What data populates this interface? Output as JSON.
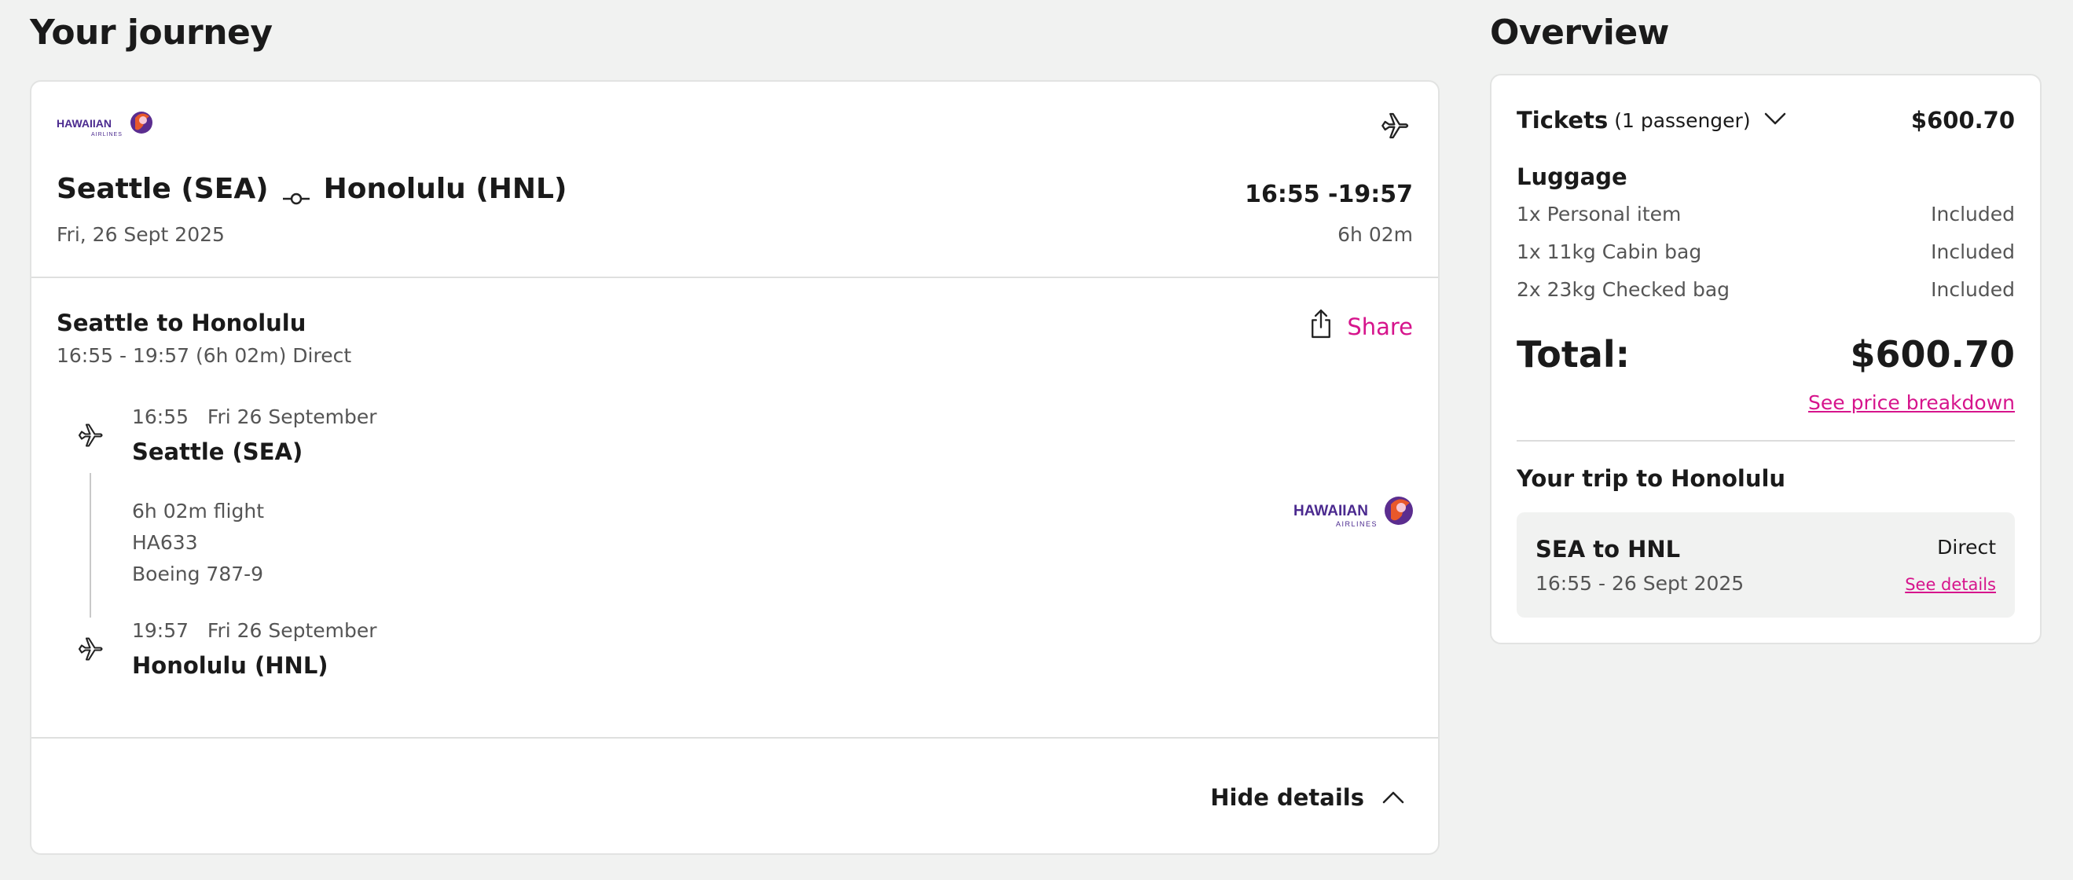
{
  "journey": {
    "title": "Your journey",
    "airline_logo_text": "HAWAIIAN",
    "airline_logo_subtext": "AIRLINES",
    "origin": "Seattle (SEA)",
    "destination": "Honolulu (HNL)",
    "date": "Fri, 26 Sept 2025",
    "time_range": "16:55 -19:57",
    "duration": "6h 02m",
    "leg": {
      "title": "Seattle to Honolulu",
      "subtitle": "16:55 - 19:57 (6h 02m) Direct",
      "share_label": "Share",
      "departure": {
        "time": "16:55   Fri 26 September",
        "name": "Seattle (SEA)"
      },
      "flight_duration": "6h 02m flight",
      "flight_number": "HA633",
      "aircraft": "Boeing 787-9",
      "arrival": {
        "time": "19:57   Fri 26 September",
        "name": "Honolulu (HNL)"
      }
    },
    "hide_details_label": "Hide details"
  },
  "overview": {
    "title": "Overview",
    "tickets_label": "Tickets",
    "tickets_passengers": "(1 passenger)",
    "tickets_price": "$600.70",
    "luggage_title": "Luggage",
    "luggage": [
      {
        "item": "1x Personal item",
        "status": "Included"
      },
      {
        "item": "1x 11kg Cabin bag",
        "status": "Included"
      },
      {
        "item": "2x 23kg Checked bag",
        "status": "Included"
      }
    ],
    "total_label": "Total:",
    "total_price": "$600.70",
    "price_breakdown_label": "See price breakdown",
    "trip_title": "Your trip to Honolulu",
    "trip": {
      "route": "SEA to HNL",
      "type": "Direct",
      "datetime": "16:55 - 26 Sept 2025",
      "details_label": "See details"
    }
  },
  "colors": {
    "accent": "#d6148c",
    "background": "#f1f2f1",
    "airline_purple": "#4b2a8f"
  }
}
